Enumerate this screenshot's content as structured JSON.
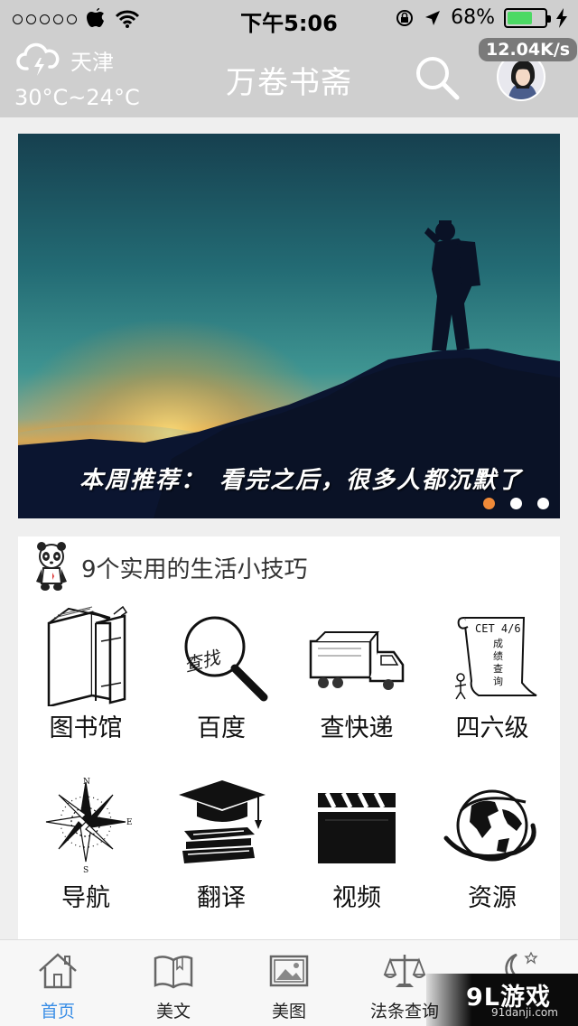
{
  "status_bar": {
    "time": "下午5:06",
    "battery": "68%",
    "battery_level": 0.68
  },
  "header": {
    "city": "天津",
    "temperature": "30°C~24°C",
    "title": "万卷书斋",
    "net_speed": "12.04K/s"
  },
  "banner": {
    "caption": "本周推荐：　看完之后，很多人都沉默了",
    "active_slide": 1,
    "slide_count": 3
  },
  "tips": {
    "title": "9个实用的生活小技巧",
    "tools": [
      {
        "label": "图书馆",
        "icon": "books-icon"
      },
      {
        "label": "百度",
        "icon": "magnifier-icon"
      },
      {
        "label": "查快递",
        "icon": "truck-icon"
      },
      {
        "label": "四六级",
        "icon": "cet-scroll-icon"
      },
      {
        "label": "导航",
        "icon": "compass-icon"
      },
      {
        "label": "翻译",
        "icon": "graduation-cap-icon"
      },
      {
        "label": "视频",
        "icon": "clapperboard-icon"
      },
      {
        "label": "资源",
        "icon": "globe-icon"
      }
    ],
    "cet_lines": [
      "CET 4/6",
      "成",
      "绩",
      "查",
      "询"
    ],
    "baidu_scribble": "查找"
  },
  "tabbar": {
    "tabs": [
      {
        "label": "首页",
        "icon": "home-icon",
        "active": true
      },
      {
        "label": "美文",
        "icon": "book-icon",
        "active": false
      },
      {
        "label": "美图",
        "icon": "picture-icon",
        "active": false
      },
      {
        "label": "法条查询",
        "icon": "scales-icon",
        "active": false
      }
    ]
  },
  "watermark": {
    "brand": "9L游戏",
    "url": "91danji.com"
  },
  "colors": {
    "accent": "#3a8ee6",
    "dot_active": "#f08a38",
    "header_bg": "#cfcfcf"
  }
}
